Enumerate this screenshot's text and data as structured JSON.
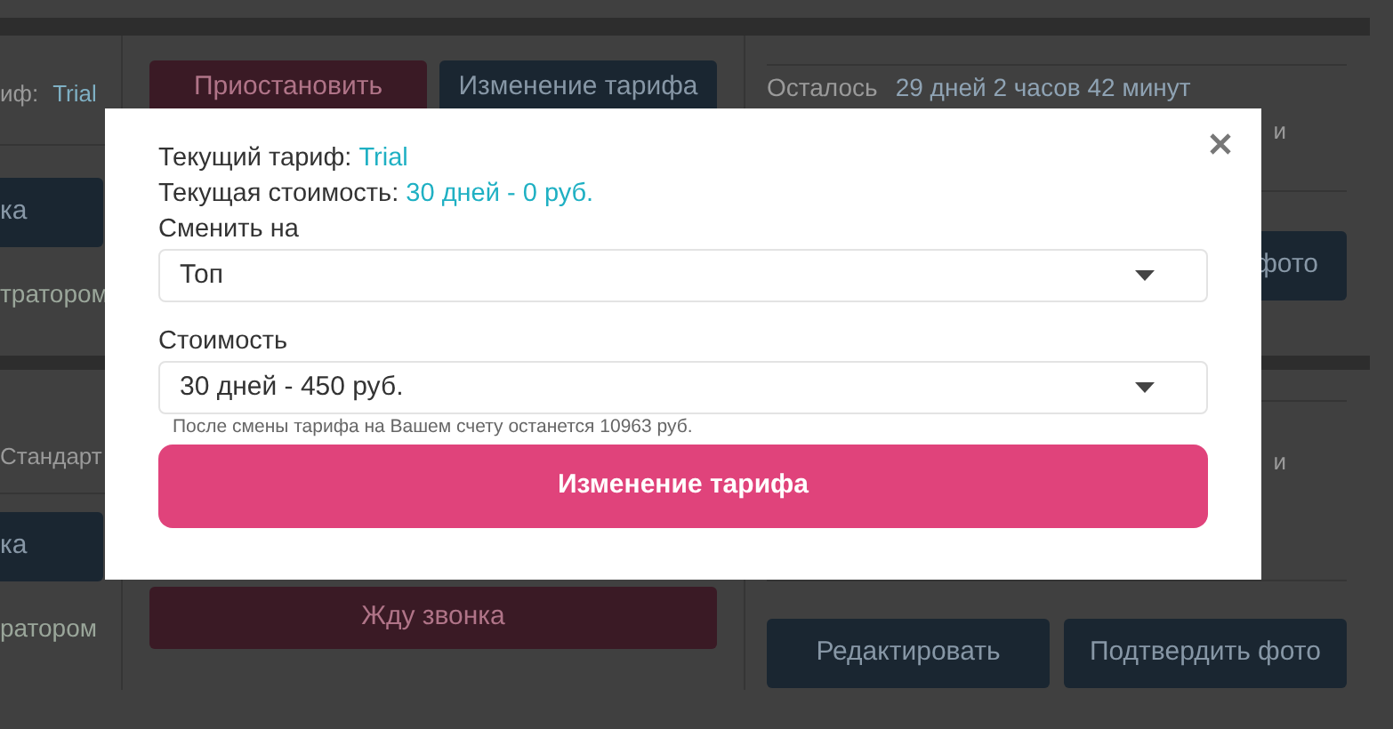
{
  "account_cards": [
    {
      "left": {
        "tariff_label": "иф:",
        "tariff_value": "Trial",
        "button": "ка",
        "role_text": "тратором"
      },
      "middle": {
        "buttons": [
          {
            "label": "Приостановить",
            "kind": "danger"
          },
          {
            "label": "Изменение тарифа",
            "kind": "primary"
          }
        ]
      },
      "right": {
        "remaining_label": "Осталось",
        "remaining_value": "29 дней 2 часов 42 минут",
        "note": "и",
        "buttons": [
          {
            "label": "фото",
            "kind": "primary"
          }
        ]
      }
    },
    {
      "left": {
        "tariff_value": "Стандарт",
        "button": "ка",
        "role_text": "ратором"
      },
      "middle": {
        "buttons": [
          {
            "label": "Жду звонка",
            "kind": "danger"
          }
        ]
      },
      "right": {
        "note": "и",
        "buttons": [
          {
            "label": "Редактировать",
            "kind": "primary"
          },
          {
            "label": "Подтвердить фото",
            "kind": "primary"
          }
        ]
      }
    }
  ],
  "modal": {
    "current_tariff": {
      "label": "Текущий тариф:",
      "value": "Trial"
    },
    "current_cost": {
      "label": "Текущая стоимость:",
      "value": "30 дней - 0 руб."
    },
    "change_to": {
      "label": "Сменить на",
      "value": "Топ"
    },
    "cost": {
      "label": "Стоимость",
      "value": "30 дней - 450 руб."
    },
    "hint": "После смены тарифа на Вашем счету останется 10963 руб.",
    "submit": "Изменение тарифа"
  }
}
